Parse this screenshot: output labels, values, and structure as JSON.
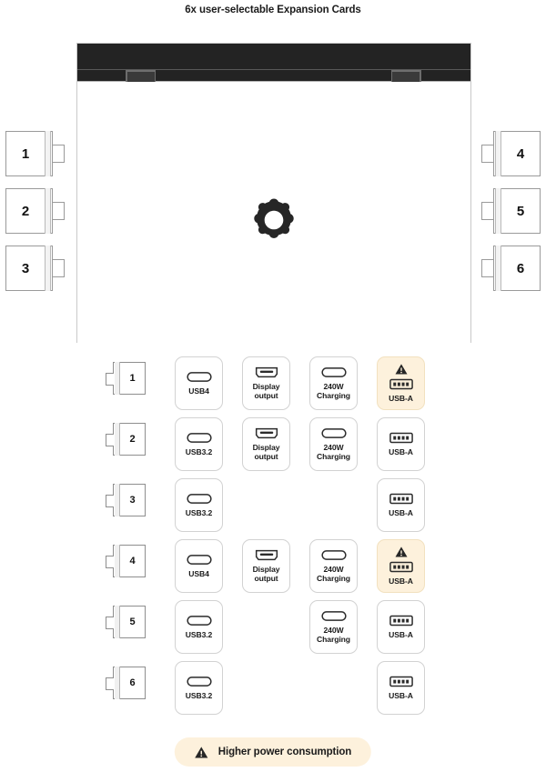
{
  "title": "6x user-selectable Expansion Cards",
  "laptop": {
    "logo_icon": "gear-logo-icon",
    "side_cards": [
      {
        "num": "1",
        "side": "left"
      },
      {
        "num": "2",
        "side": "left"
      },
      {
        "num": "3",
        "side": "left"
      },
      {
        "num": "4",
        "side": "right"
      },
      {
        "num": "5",
        "side": "right"
      },
      {
        "num": "6",
        "side": "right"
      }
    ]
  },
  "matrix": {
    "rows": [
      {
        "bay": "1",
        "cells": [
          {
            "label": "USB4",
            "icon": "usb-c-icon",
            "warn": false,
            "empty": false
          },
          {
            "label": "Display output",
            "icon": "displayport-icon",
            "warn": false,
            "empty": false
          },
          {
            "label": "240W Charging",
            "icon": "usb-c-icon",
            "warn": false,
            "empty": false
          },
          {
            "label": "USB-A",
            "icon": "usb-a-icon",
            "warn": true,
            "empty": false
          }
        ]
      },
      {
        "bay": "2",
        "cells": [
          {
            "label": "USB3.2",
            "icon": "usb-c-icon",
            "warn": false,
            "empty": false
          },
          {
            "label": "Display output",
            "icon": "displayport-icon",
            "warn": false,
            "empty": false
          },
          {
            "label": "240W Charging",
            "icon": "usb-c-icon",
            "warn": false,
            "empty": false
          },
          {
            "label": "USB-A",
            "icon": "usb-a-icon",
            "warn": false,
            "empty": false
          }
        ]
      },
      {
        "bay": "3",
        "cells": [
          {
            "label": "USB3.2",
            "icon": "usb-c-icon",
            "warn": false,
            "empty": false
          },
          {
            "label": "",
            "icon": "",
            "warn": false,
            "empty": true
          },
          {
            "label": "",
            "icon": "",
            "warn": false,
            "empty": true
          },
          {
            "label": "USB-A",
            "icon": "usb-a-icon",
            "warn": false,
            "empty": false
          }
        ]
      },
      {
        "bay": "4",
        "cells": [
          {
            "label": "USB4",
            "icon": "usb-c-icon",
            "warn": false,
            "empty": false
          },
          {
            "label": "Display output",
            "icon": "displayport-icon",
            "warn": false,
            "empty": false
          },
          {
            "label": "240W Charging",
            "icon": "usb-c-icon",
            "warn": false,
            "empty": false
          },
          {
            "label": "USB-A",
            "icon": "usb-a-icon",
            "warn": true,
            "empty": false
          }
        ]
      },
      {
        "bay": "5",
        "cells": [
          {
            "label": "USB3.2",
            "icon": "usb-c-icon",
            "warn": false,
            "empty": false
          },
          {
            "label": "",
            "icon": "",
            "warn": false,
            "empty": true
          },
          {
            "label": "240W Charging",
            "icon": "usb-c-icon",
            "warn": false,
            "empty": false
          },
          {
            "label": "USB-A",
            "icon": "usb-a-icon",
            "warn": false,
            "empty": false
          }
        ]
      },
      {
        "bay": "6",
        "cells": [
          {
            "label": "USB3.2",
            "icon": "usb-c-icon",
            "warn": false,
            "empty": false
          },
          {
            "label": "",
            "icon": "",
            "warn": false,
            "empty": true
          },
          {
            "label": "",
            "icon": "",
            "warn": false,
            "empty": true
          },
          {
            "label": "USB-A",
            "icon": "usb-a-icon",
            "warn": false,
            "empty": false
          }
        ]
      }
    ]
  },
  "legend": {
    "icon": "warning-triangle-icon",
    "text": "Higher power consumption"
  },
  "colors": {
    "warn_background": "#fdf1dc",
    "card_border": "#d2d2d2",
    "lid": "#232323",
    "text": "#1b1b1b"
  }
}
